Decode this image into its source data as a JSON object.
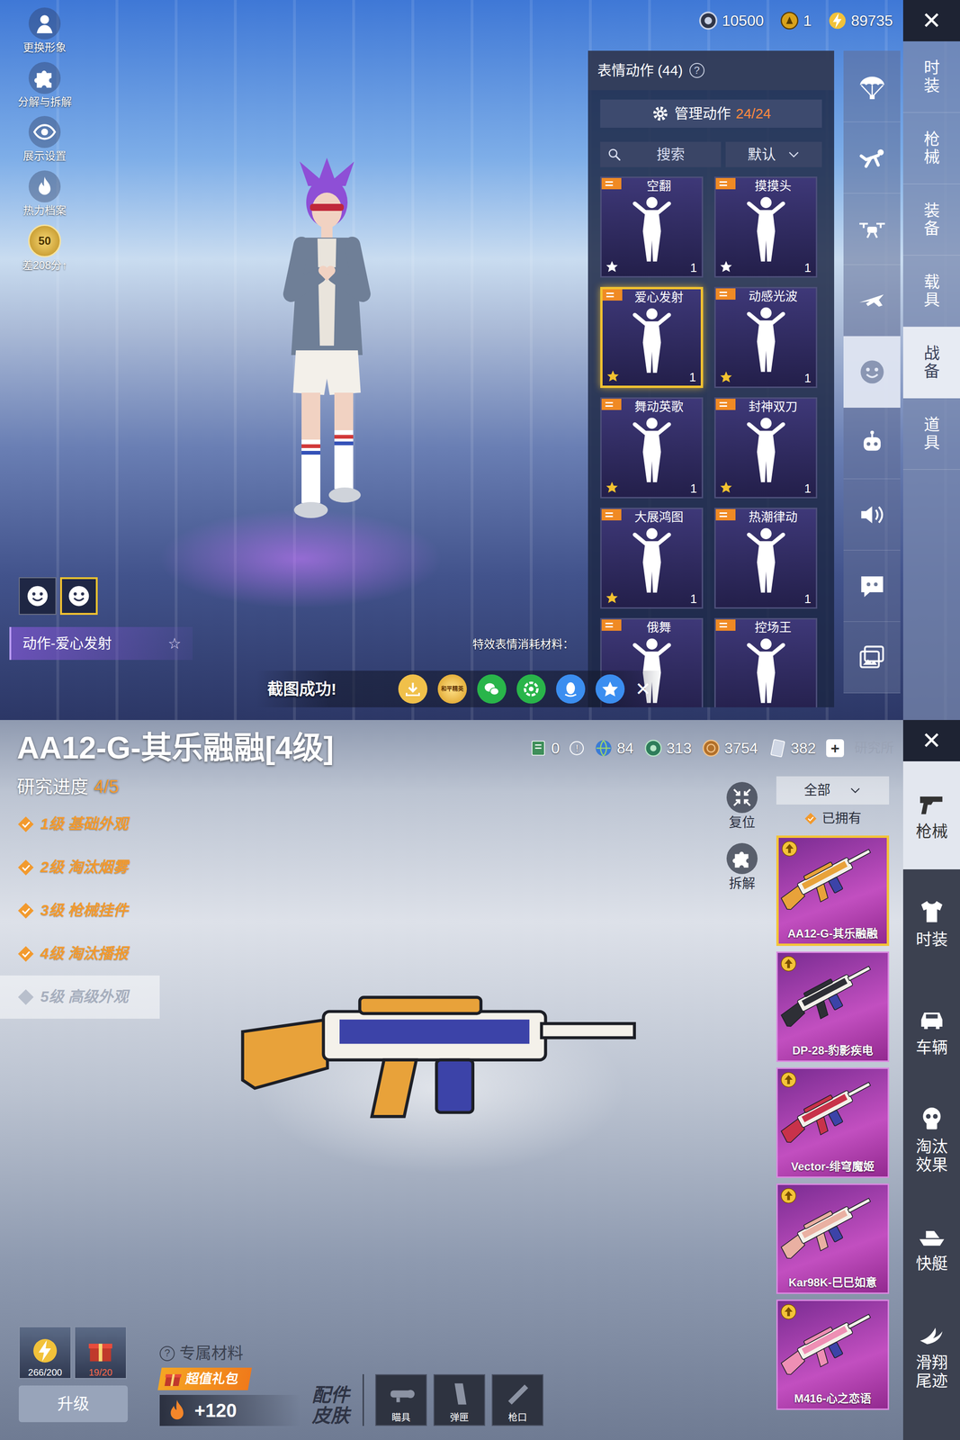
{
  "top": {
    "currency": [
      {
        "kind": "coin",
        "value": "10500"
      },
      {
        "kind": "token",
        "value": "1"
      },
      {
        "kind": "energy",
        "value": "89735"
      }
    ],
    "close": "✕",
    "menu": [
      {
        "kind": "avatar",
        "label": "更换形象"
      },
      {
        "kind": "puzzle",
        "label": "分解与拆解"
      },
      {
        "kind": "eye",
        "label": "展示设置"
      },
      {
        "kind": "flame",
        "label": "热力档案"
      }
    ],
    "rank": {
      "badge": "50",
      "label": "差208分",
      "arrow": "↑"
    },
    "panel": {
      "title": "表情动作 (44)",
      "help": "?",
      "manage": {
        "label": "管理动作",
        "count": "24/24"
      },
      "search": {
        "placeholder": "搜索"
      },
      "sort": "默认",
      "emotes": [
        {
          "name": "空翻",
          "count": "1",
          "star": "white",
          "selected": false
        },
        {
          "name": "摸摸头",
          "count": "1",
          "star": "white",
          "selected": false
        },
        {
          "name": "爱心发射",
          "count": "1",
          "star": "gold",
          "selected": true
        },
        {
          "name": "动感光波",
          "count": "1",
          "star": "gold",
          "selected": false
        },
        {
          "name": "舞动英歌",
          "count": "1",
          "star": "gold",
          "selected": false
        },
        {
          "name": "封神双刀",
          "count": "1",
          "star": "gold",
          "selected": false
        },
        {
          "name": "大展鸿图",
          "count": "1",
          "star": "gold",
          "selected": false
        },
        {
          "name": "热潮律动",
          "count": "1",
          "star": "none",
          "selected": false
        },
        {
          "name": "俄舞",
          "star": "none",
          "selected": false
        },
        {
          "name": "控场王",
          "star": "none",
          "selected": false
        }
      ]
    },
    "categories": [
      {
        "kind": "parachute",
        "selected": false
      },
      {
        "kind": "dive",
        "selected": false
      },
      {
        "kind": "drone",
        "selected": false
      },
      {
        "kind": "plane",
        "selected": false
      },
      {
        "kind": "emote",
        "selected": true
      },
      {
        "kind": "robot",
        "selected": false
      },
      {
        "kind": "sound",
        "selected": false
      },
      {
        "kind": "chat",
        "selected": false
      },
      {
        "kind": "photo",
        "selected": false
      }
    ],
    "tabs": [
      {
        "label": "时装",
        "selected": false
      },
      {
        "label": "枪械",
        "selected": false
      },
      {
        "label": "装备",
        "selected": false
      },
      {
        "label": "载具",
        "selected": false
      },
      {
        "label": "战备",
        "selected": true
      },
      {
        "label": "道具",
        "selected": false
      }
    ],
    "emote_slots": [
      {
        "selected": false
      },
      {
        "selected": true
      }
    ],
    "current": {
      "label": "动作-爱心发射",
      "favorite": "☆"
    },
    "material_label": "特效表情消耗材料：",
    "toast": "截图成功!",
    "share": {
      "buttons": [
        {
          "kind": "save"
        },
        {
          "kind": "game",
          "label": "和平精英"
        },
        {
          "kind": "wechat"
        },
        {
          "kind": "moments"
        },
        {
          "kind": "qq"
        },
        {
          "kind": "qzone"
        }
      ],
      "close": "✕"
    }
  },
  "bottom": {
    "title": "AA12-G-其乐融融[4级]",
    "progress_label": "研究进度",
    "progress": "4/5",
    "levels": [
      {
        "label": "1级 基础外观",
        "unlocked": true
      },
      {
        "label": "2级 淘汰烟雾",
        "unlocked": true
      },
      {
        "label": "3级 枪械挂件",
        "unlocked": true
      },
      {
        "label": "4级 淘汰播报",
        "unlocked": true
      },
      {
        "label": "5级 高级外观",
        "unlocked": false
      }
    ],
    "currency": [
      {
        "kind": "ticket",
        "value": "0"
      },
      {
        "kind": "globe",
        "value": "84"
      },
      {
        "kind": "gem",
        "value": "313"
      },
      {
        "kind": "bronze",
        "value": "3754"
      },
      {
        "kind": "card",
        "value": "382"
      }
    ],
    "info": "!",
    "add": "+",
    "link": "研究所",
    "close": "✕",
    "tools": [
      {
        "kind": "reset",
        "label": "复位"
      },
      {
        "kind": "split",
        "label": "拆解"
      }
    ],
    "filter": {
      "value": "全部",
      "owned_label": "已拥有",
      "owned": true
    },
    "guns": [
      {
        "name": "AA12-G-其乐融融",
        "color": "#e8a23a",
        "selected": true
      },
      {
        "name": "DP-28-豹影疾电",
        "color": "#2e2f36",
        "selected": false
      },
      {
        "name": "Vector-绯穹魔姬",
        "color": "#c8324a",
        "selected": false
      },
      {
        "name": "Kar98K-巳巳如意",
        "color": "#e9b0a2",
        "selected": false
      },
      {
        "name": "M416-心之恋语",
        "color": "#ee8fb4",
        "selected": false
      }
    ],
    "tabs": [
      {
        "kind": "pistol",
        "label": "枪械",
        "selected": true
      },
      {
        "kind": "outfit",
        "label": "时装",
        "selected": false
      },
      {
        "kind": "car",
        "label": "车辆",
        "selected": false
      },
      {
        "kind": "effect",
        "label": "淘汰效果",
        "selected": false
      },
      {
        "kind": "boat",
        "label": "快艇",
        "selected": false
      },
      {
        "kind": "trail",
        "label": "滑翔尾迹",
        "selected": false
      }
    ],
    "materials": [
      {
        "count": "266/200",
        "sufficient": true
      },
      {
        "count": "19/20",
        "sufficient": false
      }
    ],
    "upgrade": "升级",
    "exclusive": {
      "help": "?",
      "label": "专属材料"
    },
    "gift": "超值礼包",
    "boost": "+120",
    "accessory": {
      "label": "配件皮肤",
      "slots": [
        {
          "label": "瞄具"
        },
        {
          "label": "弹匣"
        },
        {
          "label": "枪口"
        }
      ]
    }
  }
}
